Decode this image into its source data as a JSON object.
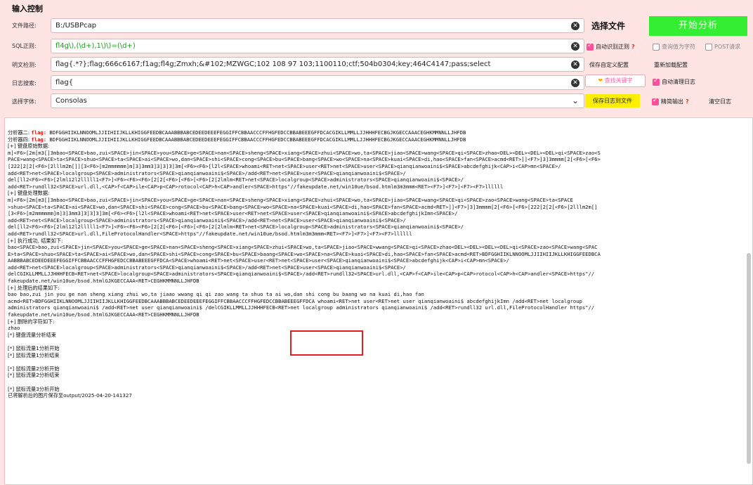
{
  "panel": {
    "title": "输入控制"
  },
  "rows": {
    "file_path": {
      "label": "文件路径:",
      "value": "B:/USBPcap"
    },
    "sql_regex": {
      "label": "SQL正则:",
      "value": "fl4g\\),(\\d+),1\\)\\)=(\\d+)"
    },
    "plaintext": {
      "label": "明文检测:",
      "value": "flag{.*?};flag;666c6167;f1ag;fl4g;Zmxh;&#102;MZWGC;102 108 97 103;1100110;ctf;504b0304;key;464C4147;pass;select"
    },
    "log_search": {
      "label": "日志搜索:",
      "value": "flag{"
    },
    "font": {
      "label": "选择字体:",
      "value": "Consolas"
    }
  },
  "buttons": {
    "choose_file": "选择文件",
    "start_analysis": "开始分析",
    "save_custom": "保存自定义配置",
    "reload_config": "重新加载配置",
    "find_keyword": "查找关键字",
    "save_log": "保存日志到文件",
    "clear_log": "清空日志"
  },
  "checkboxes": {
    "auto_regex": {
      "label": "自动识别正则",
      "checked": true
    },
    "query_char": {
      "label": "查询值为字符",
      "checked": false
    },
    "post_request": {
      "label": "POST请求",
      "checked": false
    },
    "auto_clean_log": {
      "label": "自动清理日志",
      "checked": true
    },
    "simple_output": {
      "label": "精简输出",
      "checked": true
    }
  },
  "icons": {
    "clear": "clear-icon",
    "dropdown": "chevron-down-icon",
    "find": "heart-icon",
    "help": "question-icon"
  },
  "colors": {
    "background": "#ffe4e4",
    "start_button": "#33ee33",
    "save_log_button": "#ffee00",
    "checkbox": "#ff4f9a",
    "flag_text": "#e01010",
    "regex_text": "#1a9a1a",
    "highlight_box": "#e02020"
  },
  "log": {
    "line00": "分析器二: ",
    "line00_flag": "flag:",
    "line00_rest": " BDFGGHIIKLNNOOMLJJIIHIIJKLLKHIGGFEEDBCAAABBBABCEDEEDEEEFEGGIFFCBBAACCCFFHGFEDCCBBABEEEGFFDCACGIKLLMMLLJJHHHFECBGJKGECCAAACEGHKMMNNLLJHFDB",
    "line01": "分析器四: ",
    "line01_flag": "flag:",
    "line01_rest": " BDFGGHIIKLNNOOMLJJIIHIIJKLLKHIGGFEEDBCAAABBBABCEDEEDEEEFEGGIFFCBBAACCCFFHGFEDCCBBABEEEGFFDCACGIKLLMMLLJJHHHFECBGJKGECCAAACEGHKMMNNLLJHFDB",
    "line02": "[+] 键盘原始数据:",
    "line03": "m]<F6>[2m[m3[]3mbao<SPACE>bao,zui<SPACE>jin<SPACE>you<SPACE>ge<SPACE>nan<SPACE>sheng<SPACE>xiang<SPACE>zhui<SPACE>wo,ta<SPACE>jiao<SPACE>wang<SPACE>qi<SPACE>zhao<DEL><DEL><DEL><DEL>qi<SPACE>zao<S",
    "line04": "PACE>wang<SPACE>ta<SPACE>shuo<SPACE>ta<SPACE>ai<SPACE>wo,dan<SPACE>shi<SPACE>cong<SPACE>bu<SPACE>bang<SPACE>wo<SPACE>na<SPACE>kuai<SPACE>di,hao<SPACE>fan<SPACE>acmd<RET>]]<F7>]3]3mmmm[2[<F6>[<F6>",
    "line05": "[222[2[2[<F6>[2lllm2m[]][3<F6>[m2mmmmmm]m]3]3mm3]3]3]3]3m[<F6><F6>[l2l<SPACE>whoami<RET>net<SPACE>user<RET>net<SPACE>user<SPACE>qianqianwoaini$<SPACE>abcdefghijk<CAP>i<CAP>mn<SPACE>/",
    "line06": "add<RET>net<SPACE>localgroup<SPACE>administrators<SPACE>qianqianwoaini$<SPACE>/add<RET>net<SPACE>user<SPACE>qianqianwoaini$<SPACE>/",
    "line07": "del[ll2<F6><F6>[2lml12l2lllll1<F7>]<F6><F6><F6>[2[2[<F6>[<F6>[<F6>[2[2lmlm<RET>net<SPACE>localgroup<SPACE>administrators<SPACE>qianqianwoaini$<SPACE>/",
    "line08": "add<RET>rundll32<SPACE>url.dll,<CAP>f<CAP>ile<CAP>p<CAP>rotocol<CAP>h<CAP>andler<SPACE>https\"//fakeupdate.net/win10ue/bsod.htmlm3m3mmm<RET><F7>]<F7>]<F7><F7>llllll",
    "line09": "[+] 键盘处理数据:",
    "line10": "m]<F6>[2m[m3[]3mbao<SPACE>bao,zui<SPACE>jin<SPACE>you<SPACE>ge<SPACE>nan<SPACE>sheng<SPACE>xiang<SPACE>zhui<SPACE>wo,ta<SPACE>jiao<SPACE>wang<SPACE>qi<SPACE>zao<SPACE>wang<SPACE>ta<SPACE",
    "line11": ">shuo<SPACE>ta<SPACE>ai<SPACE>wo,dan<SPACE>shi<SPACE>cong<SPACE>bu<SPACE>bang<SPACE>wo<SPACE>na<SPACE>kuai<SPACE>di,hao<SPACE>fan<SPACE>acmd<RET>]]<F7>]3]3mmmm[2[<F6>[<F6>[222[2[2[<F6>[2lllm2m[]",
    "line12": "[3<F6>[m2mmmmmm]m]3]3mm3]3]3]3]3m[<F6><F6>[l2l<SPACE>whoami<RET>net<SPACE>user<RET>net<SPACE>user<SPACE>qianqianwoaini$<SPACE>abcdefghijkImn<SPACE>/",
    "line13": "add<RET>net<SPACE>localgroup<SPACE>administrators<SPACE>qianqianwoaini$<SPACE>/add<RET>net<SPACE>user<SPACE>qianqianwoaini$<SPACE>/",
    "line14": "del[ll2<F6><F6>[2lml12l2lllll1<F7>]<F6><F6><F6>[2[2[<F6>[<F6>[<F6>[2[2lmlm<RET>net<SPACE>localgroup<SPACE>administrators<SPACE>qianqianwoaini$<SPACE>/",
    "line15": "add<RET>rundll32<SPACE>url.dll,FileProtocolHandler<SPACE>https\"//fakeupdate.net/win10ue/bsod.htmlm3m3mmm<RET><F7>]<F7>]<F7><F7>llllll",
    "line16": "[+] 执行成功, 结果如下:",
    "line17": "bao<SPACE>bao,zui<SPACE>jin<SPACE>you<SPACE>ge<SPACE>nan<SPACE>sheng<SPACE>xiang<SPACE>zhui<SPACE>wo,ta<SPACE>jiao<SPACE>wwang<SPACE>qi<SPACE>zhao<DEL><DEL><DEL><DEL>qi<SPACE>zao<SPACE>wang<SPAC",
    "line18": "E>ta<SPACE>shuo<SPACE>ta<SPACE>ai<SPACE>wo,dan<SPACE>shi<SPACE>cong<SPACE>bu<SPACE>baang<SPACE>wo<SPACE>na<SPACE>kuai<SPACE>di,hao<SPACE>fan<SPACE>acmd<RET>BDFGGHIIKLNNOOMLJJIIHIIJKLLKHIGGFEEDBCA",
    "line19": "AABBBABCEDEEDEEEFEGGIFFCBBAACCCFFHGFEDCCBBABEEEGFFDCA<SPACE>whoami<RET>net<SPACE>user<RET>net<SPACE>user<SPACE>qianqianwoaini$<SPACE>abcdefghijk<CAP>i<CAP>mn<SPACE>/",
    "line20": "add<RET>net<SPACE>localgroup<SPACE>administrators<SPACE>qianqianwoaini$<SPACE>/add<RET>net<SPACE>user<SPACE>qianqianwoaini$<SPACE>/",
    "line21": "delCGIKLLMMLLJJHHHFECB<RET>net<SPACE>localgroup<SPACE>administrators<SPACE>qianqianwoaini$<SPACE>/add<RET>rundll32<SPACE>url.dll,<CAP>f<CAP>ile<CAP>p<CAP>rotocol<CAP>h<CAP>andler<SPACE>https\"//",
    "line22": "fakeupdate.net/win10ue/bsod.htmlGJKGECCAAA<RET>CEGHKMMNNLLJHFDB",
    "line23": "[+] 处理后的结果如下:",
    "line24": "bao bao,zui jin you ge nan sheng xiang zhui wo,ta jiaao wwang qi qi zao wang ta shuo ta ai wo,dan shi cong bu baang wo na kuai di,hao fan",
    "line25": "acmd<RET>BDFGGHIIKLNNOOMLJJIIHIIJKLLKHIGGFEEDBCAAABBBABCEDEEDEEEFEGGIFFCBBAACCCFFHGFEDCCBBABEEEGFFDCA whoami<RET>net user<RET>net user qianqianwoaini$ abcdefghijkImn /add<RET>net localgroup",
    "line26": "administrators qianqianwoaini$ /add<RET>net user qianqianwoaini$ /delCGIKLLMMLLJJHHHFECB<RET>net localgroup administrators qianqianwoaini$ /add<RET>rundll32 url.dll,FileProtocolHandler https\"//",
    "line27": "fakeupdate.net/win10ue/bsod.htmlGJKGECCAAA<RET>CEGHKMMNNLLJHFDB",
    "line28": "[+] 删除的字符如下:",
    "line29": "zhao",
    "line30": "[*] 键盘流量分析结束",
    "line31": "[*] 鼠标流量1分析开始",
    "line32": "[*] 鼠标流量1分析结束",
    "line33": "[*] 鼠标流量2分析开始",
    "line34": "[*] 鼠标流量2分析结束",
    "line35": "[*] 鼠标流量3分析开始",
    "line36": "已将解析后的图片保存至output/2025-04-20-141327"
  }
}
